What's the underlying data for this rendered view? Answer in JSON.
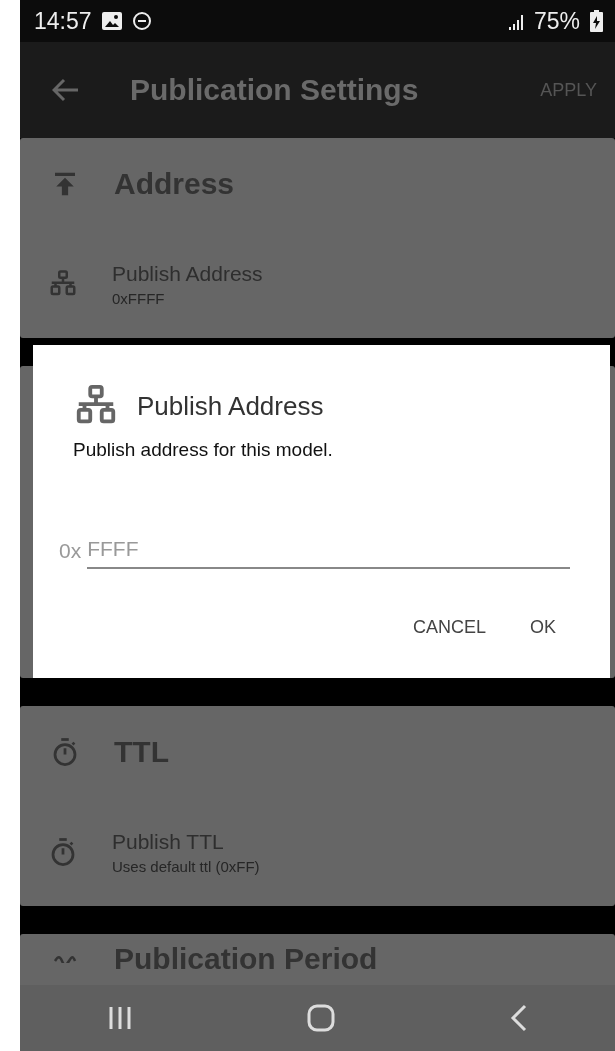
{
  "status_bar": {
    "time": "14:57",
    "battery": "75%"
  },
  "app_bar": {
    "title": "Publication Settings",
    "action": "APPLY"
  },
  "sections": [
    {
      "title": "Address",
      "items": [
        {
          "label": "Publish Address",
          "value": "0xFFFF"
        }
      ]
    },
    {
      "title": "TTL",
      "items": [
        {
          "label": "Publish TTL",
          "value": "Uses default ttl (0xFF)"
        }
      ]
    },
    {
      "title": "Publication Period"
    }
  ],
  "dialog": {
    "title": "Publish Address",
    "message": "Publish address for this model.",
    "prefix": "0x",
    "placeholder": "FFFF",
    "buttons": [
      "CANCEL",
      "OK"
    ]
  }
}
